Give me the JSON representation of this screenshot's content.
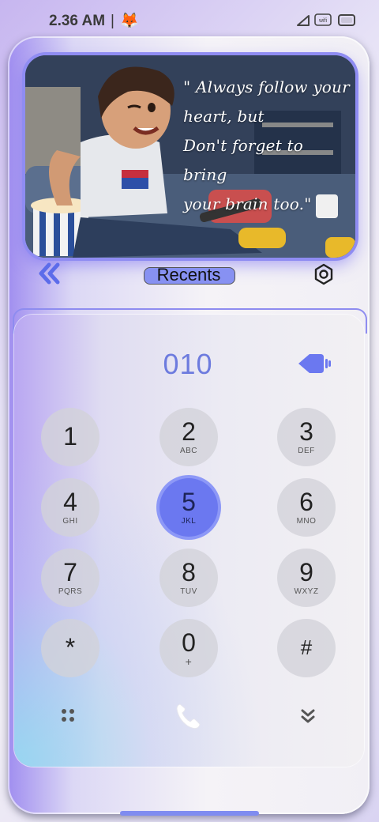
{
  "status_bar": {
    "time": "2.36 AM",
    "separator": "|"
  },
  "hero": {
    "quote_lines": [
      "\" Always follow your",
      "heart, but",
      "Don't forget to bring",
      "your brain too.\""
    ]
  },
  "toolbar": {
    "recents_label": "Recents"
  },
  "dialer": {
    "display_number": "010",
    "keys": [
      {
        "digit": "1",
        "letters": ""
      },
      {
        "digit": "2",
        "letters": "ABC"
      },
      {
        "digit": "3",
        "letters": "DEF"
      },
      {
        "digit": "4",
        "letters": "GHI"
      },
      {
        "digit": "5",
        "letters": "JKL"
      },
      {
        "digit": "6",
        "letters": "MNO"
      },
      {
        "digit": "7",
        "letters": "PQRS"
      },
      {
        "digit": "8",
        "letters": "TUV"
      },
      {
        "digit": "9",
        "letters": "WXYZ"
      },
      {
        "digit": "*",
        "letters": ""
      },
      {
        "digit": "0",
        "letters": "+"
      },
      {
        "digit": "#",
        "letters": ""
      }
    ],
    "active_key": "5"
  },
  "colors": {
    "accent": "#6b78f0",
    "display_text": "#6d7bde"
  },
  "icons": [
    "fox-icon",
    "signal-icon",
    "wifi-icon",
    "battery-icon",
    "double-chevron-left-icon",
    "settings-icon",
    "backspace-icon",
    "apps-grid-icon",
    "phone-icon",
    "double-chevron-down-icon"
  ]
}
